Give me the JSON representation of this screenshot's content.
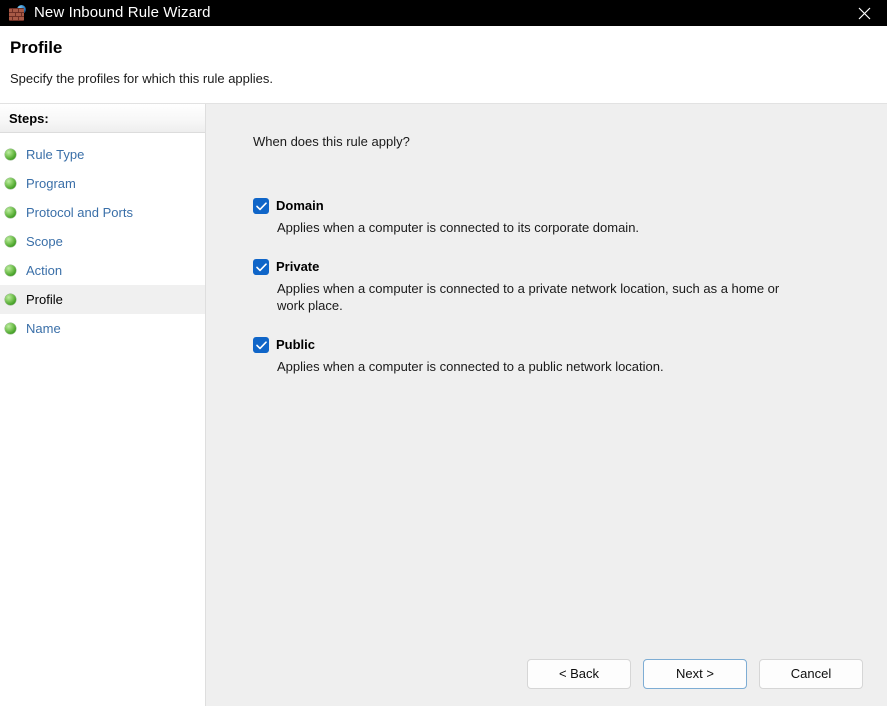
{
  "window": {
    "title": "New Inbound Rule Wizard",
    "icon": "firewall-brick-globe-icon",
    "close_label": "✕"
  },
  "header": {
    "title": "Profile",
    "subtitle": "Specify the profiles for which this rule applies."
  },
  "sidebar": {
    "heading": "Steps:",
    "items": [
      {
        "label": "Rule Type",
        "current": false
      },
      {
        "label": "Program",
        "current": false
      },
      {
        "label": "Protocol and Ports",
        "current": false
      },
      {
        "label": "Scope",
        "current": false
      },
      {
        "label": "Action",
        "current": false
      },
      {
        "label": "Profile",
        "current": true
      },
      {
        "label": "Name",
        "current": false
      }
    ]
  },
  "main": {
    "question": "When does this rule apply?",
    "profiles": [
      {
        "name": "Domain",
        "checked": true,
        "description": "Applies when a computer is connected to its corporate domain."
      },
      {
        "name": "Private",
        "checked": true,
        "description": "Applies when a computer is connected to a private network location, such as a home or work place."
      },
      {
        "name": "Public",
        "checked": true,
        "description": "Applies when a computer is connected to a public network location."
      }
    ]
  },
  "footer": {
    "back_label": "< Back",
    "next_label": "Next >",
    "cancel_label": "Cancel"
  },
  "colors": {
    "titlebar_bg": "#000000",
    "checkbox_blue": "#0f65c8",
    "link_blue": "#3a6fa8",
    "content_bg": "#efefef",
    "default_button_border": "#7eadd4",
    "step_bullet_green": "#3f9c22"
  }
}
